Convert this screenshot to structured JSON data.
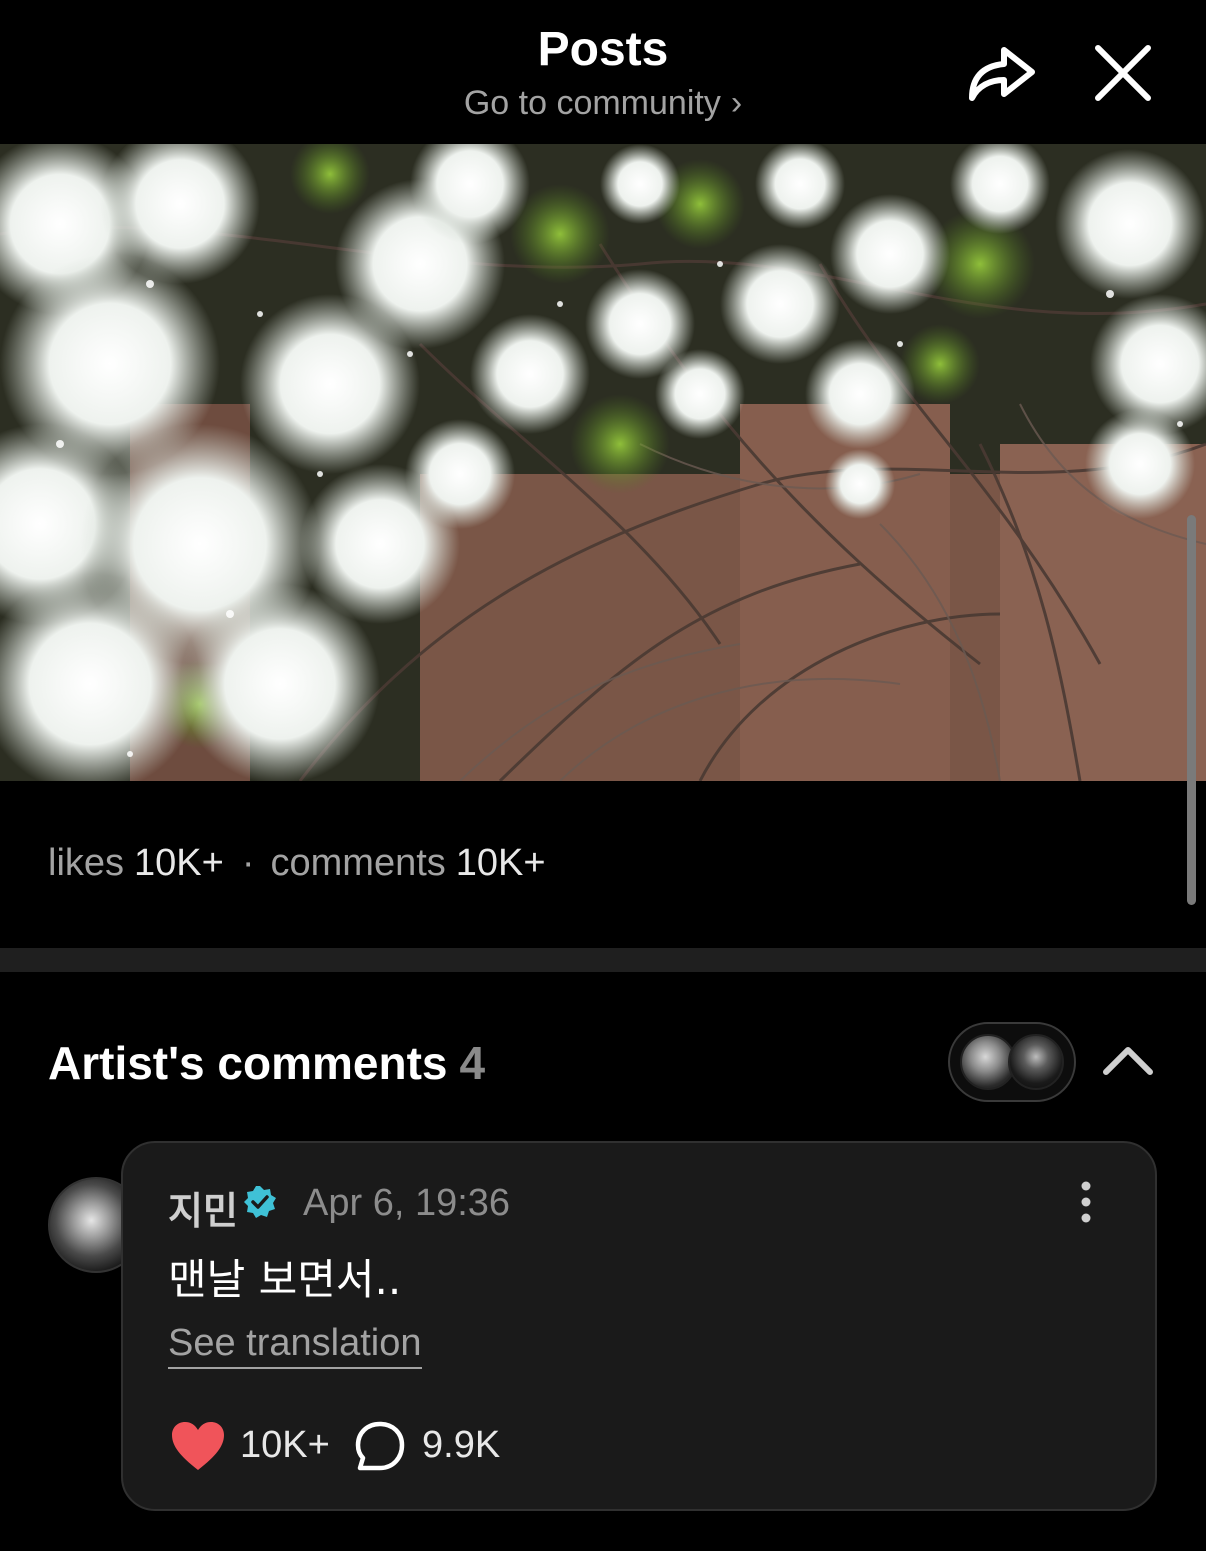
{
  "header": {
    "title": "Posts",
    "community_link": "Go to community",
    "community_chevron": "›"
  },
  "stats": {
    "likes_label": "likes",
    "likes_value": "10K+",
    "separator": "·",
    "comments_label": "comments",
    "comments_value": "10K+"
  },
  "artist_comments": {
    "title": "Artist's comments",
    "count": "4"
  },
  "comment": {
    "author": "지민",
    "date": "Apr 6, 19:36",
    "text": "맨날 보면서..",
    "see_translation": "See translation",
    "likes": "10K+",
    "replies": "9.9K"
  },
  "colors": {
    "background": "#000000",
    "card": "#1a1a1a",
    "verified": "#3fc1d6",
    "heart": "#f0545a",
    "muted_text": "#a3a3a3"
  },
  "icons": [
    "share-icon",
    "close-icon",
    "chevron-up-icon",
    "verified-icon",
    "more-vertical-icon",
    "heart-icon",
    "comment-bubble-icon"
  ]
}
